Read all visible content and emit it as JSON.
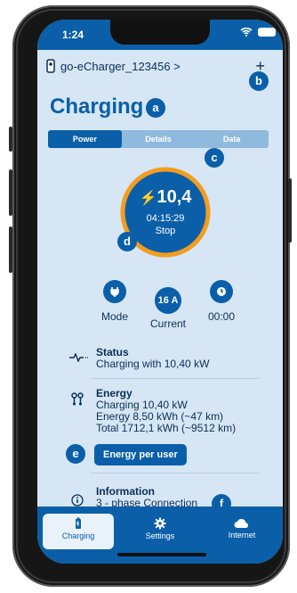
{
  "status_bar": {
    "time": "1:24"
  },
  "device": {
    "name": "go-eCharger_123456 >",
    "add_label": "+"
  },
  "page": {
    "title": "Charging"
  },
  "tabs": [
    "Power",
    "Details",
    "Data"
  ],
  "gauge": {
    "power": "10,4",
    "duration": "04:15:29",
    "action": "Stop"
  },
  "controls": [
    {
      "value": "",
      "label": "Mode",
      "icon": "plug-icon"
    },
    {
      "value": "16 A",
      "label": "Current",
      "icon": ""
    },
    {
      "value": "",
      "label": "00:00",
      "icon": "clock-icon"
    }
  ],
  "status": {
    "title": "Status",
    "text": "Charging with 10,40 kW"
  },
  "energy": {
    "title": "Energy",
    "lines": [
      "Charging 10,40 kW",
      "Energy 8,50 kWh (~47 km)",
      "Total 1712,1 kWh (~9512 km)"
    ],
    "button": "Energy per user"
  },
  "info": {
    "title": "Information",
    "text": "3 - phase Connection"
  },
  "markers": [
    "a",
    "b",
    "c",
    "d",
    "e",
    "f"
  ],
  "bottom_nav": [
    "Charging",
    "Settings",
    "Internet"
  ],
  "colors": {
    "primary": "#0a5fa8",
    "background": "#d6e6f4",
    "accent_ring": "#f39c1f",
    "text_dark": "#0b2e57"
  }
}
